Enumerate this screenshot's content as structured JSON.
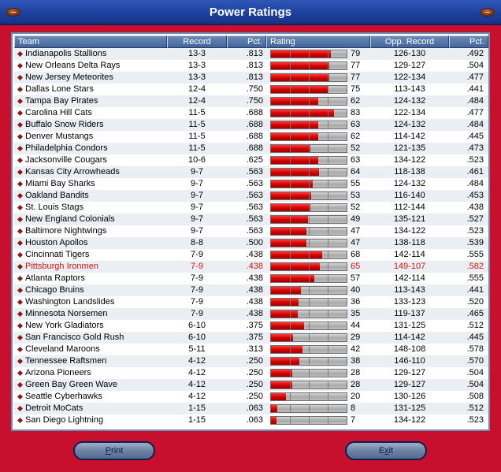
{
  "window": {
    "title": "Power Ratings"
  },
  "columns": {
    "team": "Team",
    "record": "Record",
    "pct": "Pct.",
    "rating": "Rating",
    "opp_record": "Opp. Record",
    "opp_pct": "Pct."
  },
  "rows": [
    {
      "team": "Indianapolis Stallions",
      "record": "13-3",
      "pct": ".813",
      "rating": "79",
      "opp_record": "126-130",
      "opp_pct": ".492"
    },
    {
      "team": "New Orleans Delta Rays",
      "record": "13-3",
      "pct": ".813",
      "rating": "77",
      "opp_record": "129-127",
      "opp_pct": ".504"
    },
    {
      "team": "New Jersey Meteorites",
      "record": "13-3",
      "pct": ".813",
      "rating": "77",
      "opp_record": "122-134",
      "opp_pct": ".477"
    },
    {
      "team": "Dallas Lone Stars",
      "record": "12-4",
      "pct": ".750",
      "rating": "75",
      "opp_record": "113-143",
      "opp_pct": ".441"
    },
    {
      "team": "Tampa Bay Pirates",
      "record": "12-4",
      "pct": ".750",
      "rating": "62",
      "opp_record": "124-132",
      "opp_pct": ".484"
    },
    {
      "team": "Carolina Hill Cats",
      "record": "11-5",
      "pct": ".688",
      "rating": "83",
      "opp_record": "122-134",
      "opp_pct": ".477"
    },
    {
      "team": "Buffalo Snow Riders",
      "record": "11-5",
      "pct": ".688",
      "rating": "63",
      "opp_record": "124-132",
      "opp_pct": ".484"
    },
    {
      "team": "Denver Mustangs",
      "record": "11-5",
      "pct": ".688",
      "rating": "62",
      "opp_record": "114-142",
      "opp_pct": ".445"
    },
    {
      "team": "Philadelphia Condors",
      "record": "11-5",
      "pct": ".688",
      "rating": "52",
      "opp_record": "121-135",
      "opp_pct": ".473"
    },
    {
      "team": "Jacksonville Cougars",
      "record": "10-6",
      "pct": ".625",
      "rating": "63",
      "opp_record": "134-122",
      "opp_pct": ".523"
    },
    {
      "team": "Kansas City Arrowheads",
      "record": "9-7",
      "pct": ".563",
      "rating": "64",
      "opp_record": "118-138",
      "opp_pct": ".461"
    },
    {
      "team": "Miami Bay Sharks",
      "record": "9-7",
      "pct": ".563",
      "rating": "55",
      "opp_record": "124-132",
      "opp_pct": ".484"
    },
    {
      "team": "Oakland Bandits",
      "record": "9-7",
      "pct": ".563",
      "rating": "53",
      "opp_record": "116-140",
      "opp_pct": ".453"
    },
    {
      "team": "St. Louis Stags",
      "record": "9-7",
      "pct": ".563",
      "rating": "52",
      "opp_record": "112-144",
      "opp_pct": ".438"
    },
    {
      "team": "New England Colonials",
      "record": "9-7",
      "pct": ".563",
      "rating": "49",
      "opp_record": "135-121",
      "opp_pct": ".527"
    },
    {
      "team": "Baltimore Nightwings",
      "record": "9-7",
      "pct": ".563",
      "rating": "47",
      "opp_record": "134-122",
      "opp_pct": ".523"
    },
    {
      "team": "Houston Apollos",
      "record": "8-8",
      "pct": ".500",
      "rating": "47",
      "opp_record": "138-118",
      "opp_pct": ".539"
    },
    {
      "team": "Cincinnati Tigers",
      "record": "7-9",
      "pct": ".438",
      "rating": "68",
      "opp_record": "142-114",
      "opp_pct": ".555"
    },
    {
      "team": "Pittsburgh Ironmen",
      "record": "7-9",
      "pct": ".438",
      "rating": "65",
      "opp_record": "149-107",
      "opp_pct": ".582",
      "highlight": true
    },
    {
      "team": "Atlanta Raptors",
      "record": "7-9",
      "pct": ".438",
      "rating": "57",
      "opp_record": "142-114",
      "opp_pct": ".555"
    },
    {
      "team": "Chicago Bruins",
      "record": "7-9",
      "pct": ".438",
      "rating": "40",
      "opp_record": "113-143",
      "opp_pct": ".441"
    },
    {
      "team": "Washington Landslides",
      "record": "7-9",
      "pct": ".438",
      "rating": "36",
      "opp_record": "133-123",
      "opp_pct": ".520"
    },
    {
      "team": "Minnesota Norsemen",
      "record": "7-9",
      "pct": ".438",
      "rating": "35",
      "opp_record": "119-137",
      "opp_pct": ".465"
    },
    {
      "team": "New York Gladiators",
      "record": "6-10",
      "pct": ".375",
      "rating": "44",
      "opp_record": "131-125",
      "opp_pct": ".512"
    },
    {
      "team": "San Francisco Gold Rush",
      "record": "6-10",
      "pct": ".375",
      "rating": "29",
      "opp_record": "114-142",
      "opp_pct": ".445"
    },
    {
      "team": "Cleveland Maroons",
      "record": "5-11",
      "pct": ".313",
      "rating": "42",
      "opp_record": "148-108",
      "opp_pct": ".578"
    },
    {
      "team": "Tennessee Raftsmen",
      "record": "4-12",
      "pct": ".250",
      "rating": "38",
      "opp_record": "146-110",
      "opp_pct": ".570"
    },
    {
      "team": "Arizona Pioneers",
      "record": "4-12",
      "pct": ".250",
      "rating": "28",
      "opp_record": "129-127",
      "opp_pct": ".504"
    },
    {
      "team": "Green Bay Green Wave",
      "record": "4-12",
      "pct": ".250",
      "rating": "28",
      "opp_record": "129-127",
      "opp_pct": ".504"
    },
    {
      "team": "Seattle Cyberhawks",
      "record": "4-12",
      "pct": ".250",
      "rating": "20",
      "opp_record": "130-126",
      "opp_pct": ".508"
    },
    {
      "team": "Detroit MoCats",
      "record": "1-15",
      "pct": ".063",
      "rating": "8",
      "opp_record": "131-125",
      "opp_pct": ".512"
    },
    {
      "team": "San Diego Lightning",
      "record": "1-15",
      "pct": ".063",
      "rating": "7",
      "opp_record": "134-122",
      "opp_pct": ".523"
    }
  ],
  "rating_bar": {
    "max": 100,
    "fill_color": "#d00000",
    "highlight_color": "#d21414"
  },
  "buttons": {
    "print": {
      "accel": "P",
      "rest": "rint"
    },
    "exit": {
      "pre": "E",
      "accel": "x",
      "rest": "it"
    }
  }
}
